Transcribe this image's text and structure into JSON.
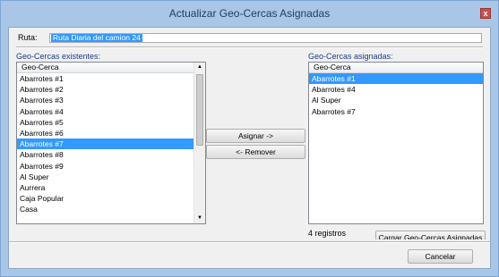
{
  "window": {
    "title": "Actualizar Geo-Cercas Asignadas",
    "close_glyph": "x"
  },
  "ruta": {
    "label": "Ruta:",
    "value": "Ruta Diaria del camion 24"
  },
  "existentes": {
    "label": "Geo-Cercas existentes:",
    "column_header": "Geo-Cerca",
    "items": [
      "Abarrotes #1",
      "Abarrotes #2",
      "Abarrotes #3",
      "Abarrotes #4",
      "Abarrotes #5",
      "Abarrotes #6",
      "Abarrotes #7",
      "Abarrotes #8",
      "Abarrotes #9",
      "Al Super",
      "Aurrera",
      "Caja Popular",
      "Casa"
    ],
    "selected_index": 6
  },
  "buttons": {
    "assign": "Asignar ->",
    "remove": "<- Remover",
    "load": "Cargar Geo-Cercas Asignadas",
    "cancel": "Cancelar"
  },
  "asignadas": {
    "label": "Geo-Cercas asignadas:",
    "column_header": "Geo-Cerca",
    "items": [
      "Abarrotes #1",
      "Abarrotes #4",
      "Al Super",
      "Abarrotes #7"
    ],
    "selected_index": 0,
    "count_text": "4 registros"
  },
  "icons": {
    "scroll_up": "up-arrow",
    "scroll_down": "down-arrow",
    "close": "close-icon"
  },
  "colors": {
    "selection": "#3399ff",
    "title_text": "#1f3d66",
    "label_blue": "#1d3b8c",
    "close_button": "#c75050"
  }
}
